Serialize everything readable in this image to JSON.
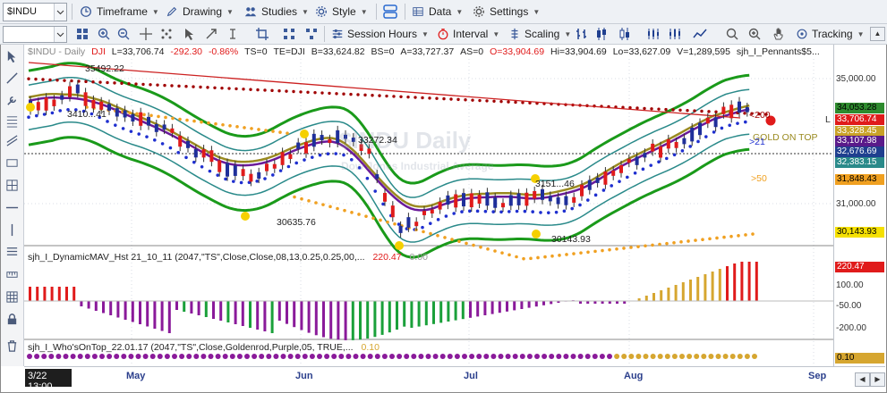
{
  "toolbar": {
    "symbol": "$INDU",
    "timeframe": "Timeframe",
    "drawing": "Drawing",
    "studies": "Studies",
    "style": "Style",
    "data": "Data",
    "settings": "Settings"
  },
  "toolbar2": {
    "session_hours": "Session Hours",
    "interval": "Interval",
    "scaling": "Scaling",
    "tracking": "Tracking"
  },
  "header": {
    "symbol_name": "$INDU - Daily",
    "exchange": "DJI",
    "last": "L=33,706.74",
    "change": "-292.30",
    "change_pct": "-0.86%",
    "ts": "TS=0",
    "te": "TE=DJI",
    "bid": "B=33,624.82",
    "bs": "BS=0",
    "ask": "A=33,727.37",
    "as": "AS=0",
    "open": "O=33,904.69",
    "high": "Hi=33,904.69",
    "low": "Lo=33,627.09",
    "volume": "V=1,289,595",
    "study": "sjh_I_Pennants$5..."
  },
  "watermark": {
    "title": "$INDU Daily",
    "subtitle": "Dow Jones Industrial Average"
  },
  "price_annotations": {
    "a1": "35492.22",
    "a2": "3410...41",
    "a3": "33272.34",
    "a4": "30635.76",
    "a5": "3151...46",
    "a6": "30143.93"
  },
  "ma_labels": {
    "m200": "<200",
    "gold": "GOLD ON TOP",
    "m21": ">21",
    "m50": ">50",
    "L": "L"
  },
  "price_axis": {
    "ticks": [
      "35,000.00",
      "31,000.00"
    ],
    "tags": [
      {
        "value": "34,053.28",
        "bg": "#2e8b2e",
        "fg": "#000000"
      },
      {
        "value": "33,706.74",
        "bg": "#e01b1b",
        "fg": "#ffffff"
      },
      {
        "value": "33,328.45",
        "bg": "#c9a227",
        "fg": "#ffffff"
      },
      {
        "value": "33,107.98",
        "bg": "#5a1a8a",
        "fg": "#ffffff"
      },
      {
        "value": "32,676.69",
        "bg": "#1f3f8f",
        "fg": "#ffffff"
      },
      {
        "value": "32,383.15",
        "bg": "#2a8a8a",
        "fg": "#ffffff"
      },
      {
        "value": "31,848.43",
        "bg": "#f0a020",
        "fg": "#000000"
      },
      {
        "value": "30,143.93",
        "bg": "#f5e000",
        "fg": "#000000"
      }
    ]
  },
  "panel1": {
    "title": "sjh_I_DynamicMAV_Hst 21_10_11 (2047,\"TS\",Close,Close,08,13,0.25,0.25,00,...",
    "v1": "220.47",
    "v2": "0.00",
    "ticks": [
      "100.00",
      "-50.00",
      "-200.00"
    ],
    "tag": "220.47"
  },
  "panel2": {
    "title": "sjh_I_Who'sOnTop_22.01.17 (2047,\"TS\",Close,Goldenrod,Purple,05, TRUE,...",
    "v1": "0.10",
    "tag": "0.10"
  },
  "time_axis": {
    "cursor": "3/22 13:00",
    "months": [
      "May",
      "Jun",
      "Jul",
      "Aug",
      "Sep"
    ]
  },
  "colors": {
    "up": "#1f2f9a",
    "down": "#e01b1b",
    "band_outer": "#1a9a1a",
    "band_inner": "#2a8a8a",
    "ma_gold": "#9a8a20",
    "ma_purple": "#6a1a9a",
    "dots_200": "#a00000",
    "dots_50": "#f0a020",
    "dots_21": "#1f2fcf",
    "trendline": "#cc2020",
    "hist_red": "#e01b1b",
    "hist_gold": "#d6a630",
    "hist_green": "#1aa03a",
    "hist_purple": "#8a1a9a"
  }
}
